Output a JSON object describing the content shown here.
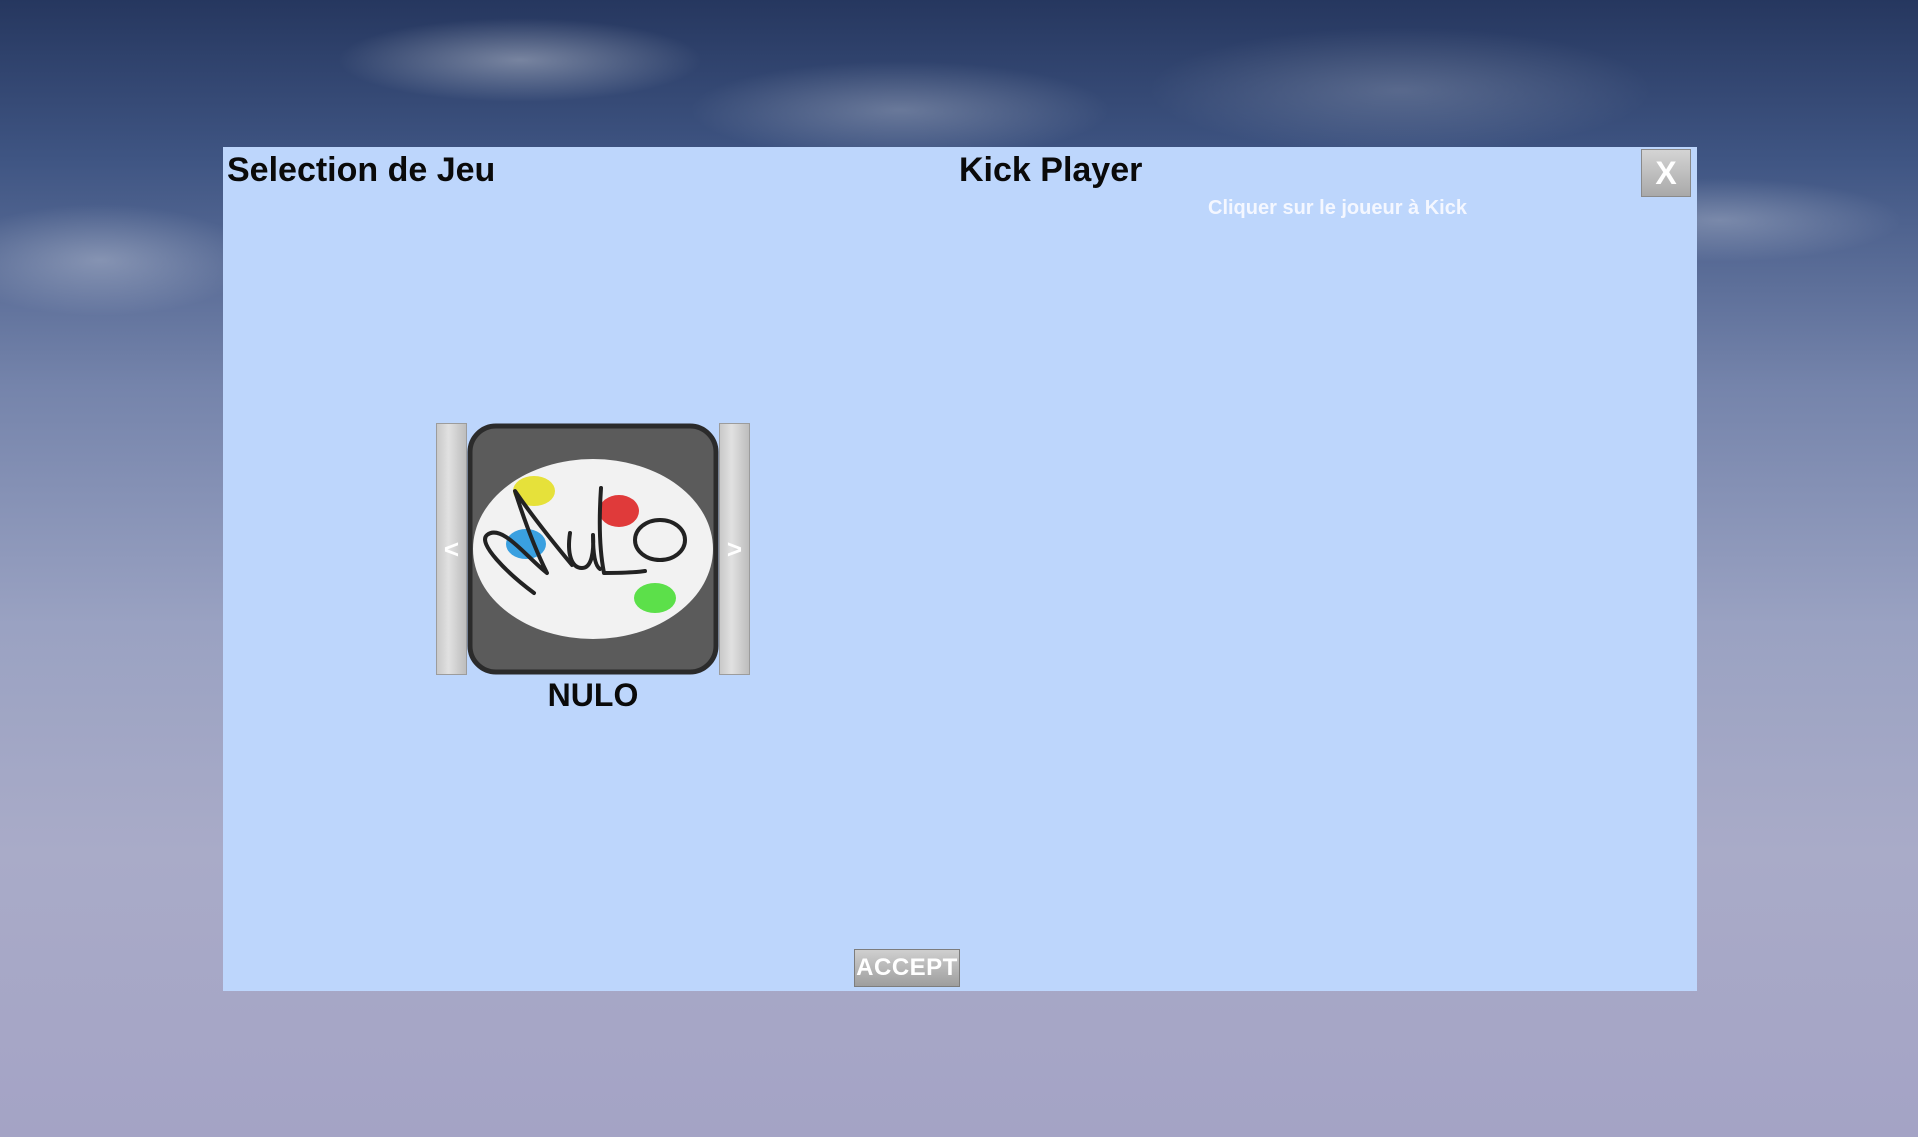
{
  "game_panel": {
    "title": "Selection de Jeu",
    "prev_label": "<",
    "next_label": ">",
    "selected_game": {
      "name": "NULO",
      "logo_text": "NuLo"
    }
  },
  "kick_panel": {
    "title": "Kick Player",
    "hint": "Cliquer sur le joueur à Kick"
  },
  "close_label": "X",
  "accept_label": "ACCEPT",
  "colors": {
    "panel_bg": "#bdd6fc",
    "button_gray": "#a9a9a9",
    "logo_yellow": "#e6e13a",
    "logo_red": "#e03a3a",
    "logo_blue": "#3aa0e0",
    "logo_green": "#5ce04a"
  }
}
